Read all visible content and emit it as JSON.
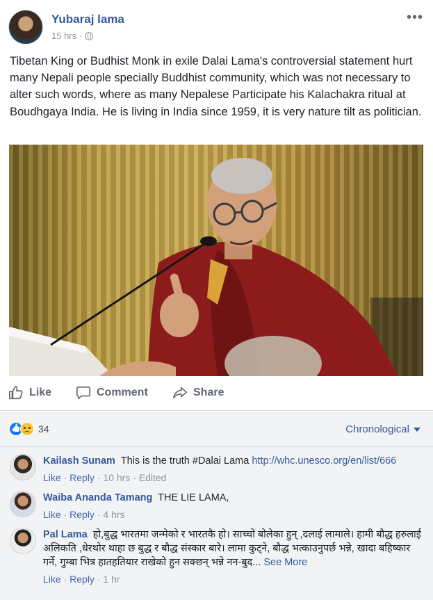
{
  "post": {
    "author": "Yubaraj lama",
    "time": "15 hrs",
    "dot": "·",
    "more_glyph": "•••",
    "text": "Tibetan King or Budhist Monk in exile Dalai Lama's controversial statement hurt many Nepali people specially Buddhist community, which was not necessary to alter such words, where as many Nepalese Participate his Kalachakra ritual at Boudhgaya India. He is living in India since 1959, it is very nature tilt as politician."
  },
  "actions": {
    "like": "Like",
    "comment": "Comment",
    "share": "Share"
  },
  "reactions": {
    "count": "34",
    "sort_label": "Chronological"
  },
  "comments": [
    {
      "name": "Kailash Sunam",
      "text": "This is the truth #Dalai Lama",
      "link": "http://whc.unesco.org/en/list/666",
      "like": "Like",
      "reply": "Reply",
      "time": "10 hrs",
      "edited": "Edited"
    },
    {
      "name": "Waiba Ananda Tamang",
      "text": "THE LIE LAMA,",
      "like": "Like",
      "reply": "Reply",
      "time": "4 hrs"
    },
    {
      "name": "Pal Lama",
      "text": "हो,बुद्ध भारतमा जन्मेको र भारतकै हो। साच्चो बोलेका हुन् ,दलाई लामाले। हामी बौद्ध हरुलाई अलिकति ,धेरथोर थाहा छ बुद्ध र बौद्ध संस्कार बारे। लामा कुट्ने, बौद्ध भत्काउनुपर्छ भन्ने, खादा बहिष्कार गर्ने, गुम्बा भित्र हातहतियार राखेको हुन सक्छन् भन्ने नन-बुद...",
      "see_more": "See More",
      "like": "Like",
      "reply": "Reply",
      "time": "1 hr"
    }
  ],
  "colors": {
    "brand_link": "#365899",
    "meta_gray": "#90949c",
    "comment_bg": "#f2f3f5"
  },
  "icons": [
    "globe-icon",
    "more-icon",
    "like-icon",
    "comment-icon",
    "share-icon",
    "like-reaction-icon",
    "sad-reaction-icon",
    "chevron-down-icon"
  ]
}
